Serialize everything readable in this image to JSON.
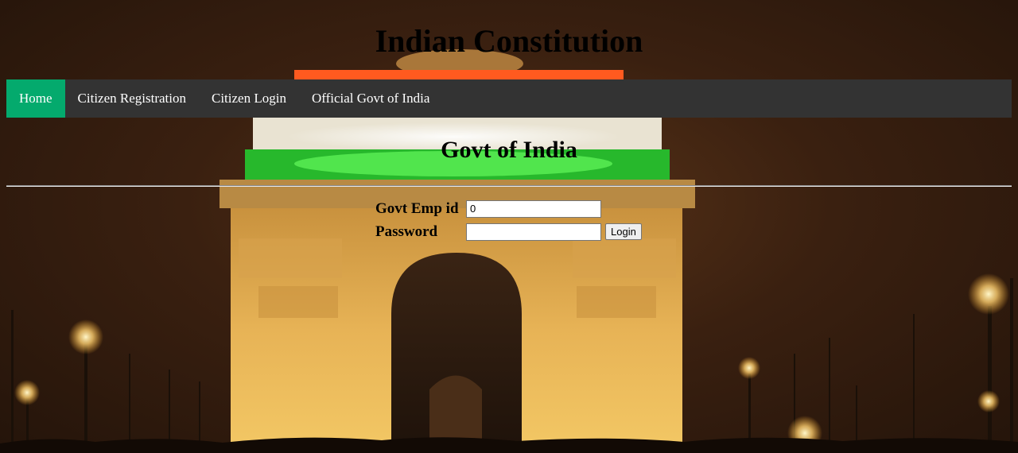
{
  "header": {
    "title": "Indian Constitution"
  },
  "nav": {
    "items": [
      {
        "label": "Home",
        "active": true
      },
      {
        "label": "Citizen Registration",
        "active": false
      },
      {
        "label": "Citizen Login",
        "active": false
      },
      {
        "label": "Official Govt of India",
        "active": false
      }
    ]
  },
  "main": {
    "section_title": "Govt of India",
    "form": {
      "emp_id_label": "Govt Emp id",
      "emp_id_value": "0",
      "password_label": "Password",
      "password_value": "",
      "login_label": "Login"
    }
  },
  "colors": {
    "nav_bg": "#333333",
    "nav_active": "#04AA6D",
    "nav_text": "#ffffff"
  },
  "background": {
    "subject": "India Gate at night with tricolour lighting"
  }
}
